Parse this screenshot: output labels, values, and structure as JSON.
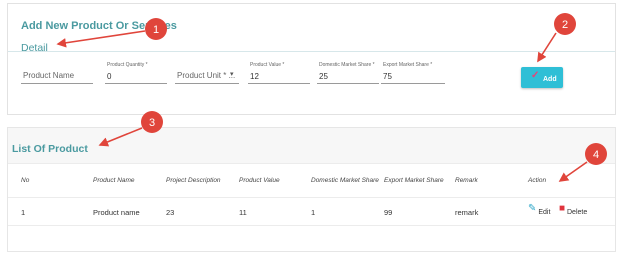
{
  "add_section": {
    "title": "Add New Product Or Services",
    "detail_label": "Detail",
    "fields": {
      "product_name": {
        "placeholder": "Product Name"
      },
      "product_quantity": {
        "label": "Product Quantity *",
        "value": "0"
      },
      "product_unit": {
        "placeholder": "Product Unit * ..."
      },
      "product_value": {
        "label": "Product Value *",
        "value": "12"
      },
      "domestic_share": {
        "label": "Domestic Market Share *",
        "value": "25"
      },
      "export_share": {
        "label": "Export Market Share *",
        "value": "75"
      }
    },
    "add_button_label": "Add"
  },
  "list_section": {
    "title": "List Of Product",
    "columns": [
      "No",
      "Product Name",
      "Project Description",
      "Product Value",
      "Domestic Market Share",
      "Export Market Share",
      "Remark",
      "Action"
    ],
    "rows": [
      {
        "no": "1",
        "product_name": "Product name",
        "project_description": "23",
        "product_value": "11",
        "domestic_share": "1",
        "export_share": "99",
        "remark": "remark",
        "edit_label": "Edit",
        "delete_label": "Delete"
      }
    ]
  },
  "annotations": [
    "1",
    "2",
    "3",
    "4"
  ],
  "colors": {
    "accent": "#4a9aa0",
    "button": "#2fbfd6",
    "annotation": "#e0453b"
  }
}
